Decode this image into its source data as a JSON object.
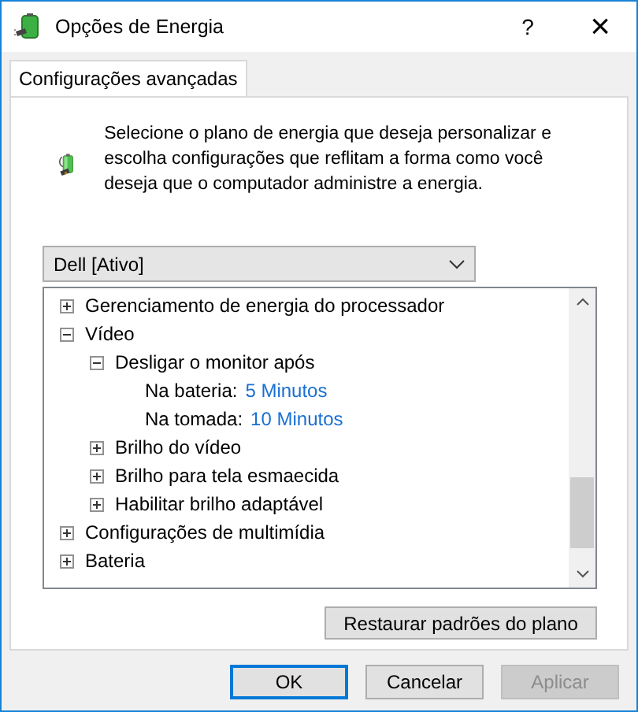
{
  "window": {
    "title": "Opções de Energia",
    "help": "?",
    "close": "×"
  },
  "tabs": [
    {
      "label": "Configurações avançadas",
      "selected": true
    }
  ],
  "description": "Selecione o plano de energia que deseja personalizar e escolha configurações que reflitam a forma como você deseja que o computador administre a energia.",
  "plan_dropdown": {
    "value": "Dell [Ativo]"
  },
  "tree": [
    {
      "label": "Gerenciamento de energia do processador",
      "expanded": false
    },
    {
      "label": "Vídeo",
      "expanded": true,
      "children": [
        {
          "label": "Desligar o monitor após",
          "expanded": true,
          "children": [
            {
              "label": "Na bateria:",
              "value": "5 Minutos"
            },
            {
              "label": "Na tomada:",
              "value": "10 Minutos"
            }
          ]
        },
        {
          "label": "Brilho do vídeo",
          "expanded": false
        },
        {
          "label": "Brilho para tela esmaecida",
          "expanded": false
        },
        {
          "label": "Habilitar brilho adaptável",
          "expanded": false
        }
      ]
    },
    {
      "label": "Configurações de multimídia",
      "expanded": false
    },
    {
      "label": "Bateria",
      "expanded": false
    }
  ],
  "restore_button": "Restaurar padrões do plano",
  "buttons": [
    {
      "label": "OK",
      "default": true,
      "disabled": false
    },
    {
      "label": "Cancelar",
      "default": false,
      "disabled": false
    },
    {
      "label": "Aplicar",
      "default": false,
      "disabled": true
    }
  ]
}
